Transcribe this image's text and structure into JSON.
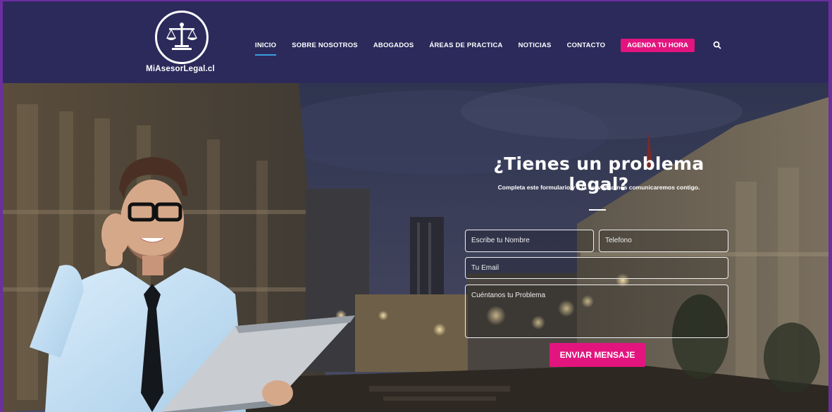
{
  "site": {
    "logo_text": "MiAsesorLegal.cl"
  },
  "nav": {
    "items": [
      {
        "label": "INICIO",
        "active": true
      },
      {
        "label": "SOBRE NOSOTROS"
      },
      {
        "label": "ABOGADOS"
      },
      {
        "label": "ÁREAS DE PRACTICA"
      },
      {
        "label": "NOTICIAS"
      },
      {
        "label": "CONTACTO"
      }
    ],
    "cta_label": "AGENDA TU HORA",
    "search_icon": "search-icon"
  },
  "hero": {
    "title": "¿Tienes un problema legal?",
    "subtitle": "Completa este formulario y a la brevedad nos comunicaremos contigo.",
    "form": {
      "name_placeholder": "Escribe tu Nombre",
      "phone_placeholder": "Telefono",
      "email_placeholder": "Tu Email",
      "problem_placeholder": "Cuéntanos tu Problema",
      "submit_label": "ENVIAR MENSAJE"
    }
  },
  "colors": {
    "header_bg": "#2c2a5b",
    "accent_pink": "#e3147e",
    "active_underline": "#3aa0e0",
    "page_border": "#6b2fa0"
  }
}
